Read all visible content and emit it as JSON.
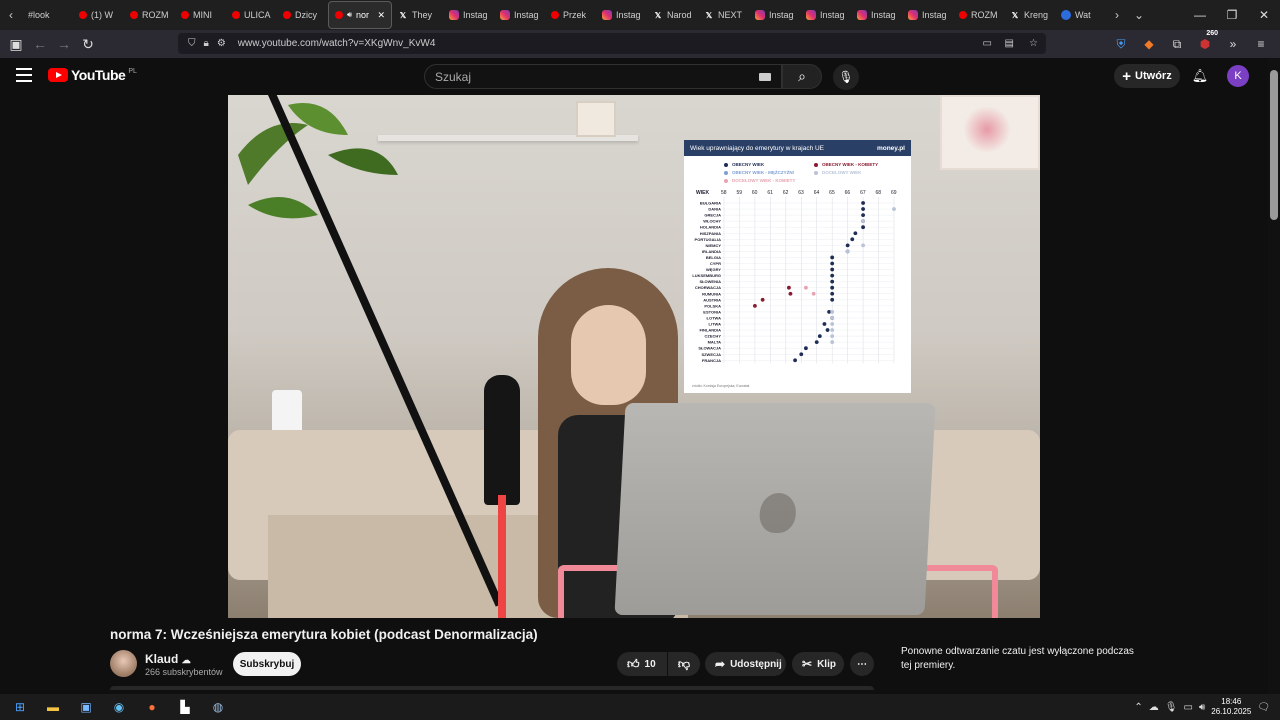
{
  "browser": {
    "tabs": [
      {
        "label": "#look",
        "icon": "none"
      },
      {
        "label": "(1) W",
        "icon": "youtube"
      },
      {
        "label": "ROZM",
        "icon": "youtube"
      },
      {
        "label": "MINI",
        "icon": "youtube"
      },
      {
        "label": "ULICA",
        "icon": "youtube"
      },
      {
        "label": "Dzicy",
        "icon": "youtube"
      },
      {
        "label": "nor",
        "icon": "youtube",
        "active": true
      },
      {
        "label": "They",
        "icon": "x"
      },
      {
        "label": "Instag",
        "icon": "instagram"
      },
      {
        "label": "Instag",
        "icon": "instagram"
      },
      {
        "label": "Przek",
        "icon": "youtube"
      },
      {
        "label": "Instag",
        "icon": "instagram"
      },
      {
        "label": "Narod",
        "icon": "x"
      },
      {
        "label": "NEXT",
        "icon": "x"
      },
      {
        "label": "Instag",
        "icon": "instagram"
      },
      {
        "label": "Instag",
        "icon": "instagram"
      },
      {
        "label": "Instag",
        "icon": "instagram"
      },
      {
        "label": "Instag",
        "icon": "instagram"
      },
      {
        "label": "ROZM",
        "icon": "youtube"
      },
      {
        "label": "Kreng",
        "icon": "x"
      },
      {
        "label": "Wat",
        "icon": "go"
      }
    ],
    "url": "www.youtube.com/watch?v=XKgWnv_KvW4",
    "badge_count": "260"
  },
  "youtube": {
    "logo_text": "YouTube",
    "region": "PL",
    "search_placeholder": "Szukaj",
    "create_label": "Utwórz",
    "avatar_letter": "K"
  },
  "video_chart": {
    "title": "Wiek uprawniający do emerytury w krajach UE",
    "brand": "money.pl",
    "legend": [
      {
        "label": "OBECNY WIEK",
        "color": "#1f2d55"
      },
      {
        "label": "OBECNY WIEK - KOBIETY",
        "color": "#8a1a2f"
      },
      {
        "label": "OBECNY WIEK - MĘŻCZYŹNI",
        "color": "#7f9fd1"
      },
      {
        "label": "DOCELOWY WIEK",
        "color": "#b8c2d8"
      },
      {
        "label": "DOCELOWY WIEK - KOBIETY",
        "color": "#e7a4b0"
      }
    ],
    "axis_label": "WIEK",
    "ticks": [
      "58",
      "59",
      "60",
      "61",
      "62",
      "63",
      "64",
      "65",
      "66",
      "67",
      "68",
      "69"
    ],
    "source": "źródło: Komisja Europejska, Eurostat"
  },
  "chart_data": {
    "type": "scatter",
    "title": "Wiek uprawniający do emerytury w krajach UE",
    "xlabel": "WIEK",
    "xlim": [
      58,
      69
    ],
    "categories": [
      "BUŁGARIA",
      "DANIA",
      "GRECJA",
      "WŁOCHY",
      "HOLANDIA",
      "HISZPANIA",
      "PORTUGALIA",
      "NIEMCY",
      "IRLANDIA",
      "BELGIA",
      "CYPR",
      "WĘGRY",
      "LUKSEMBURG",
      "SŁOWENIA",
      "CHORWACJA",
      "RUMUNIA",
      "AUSTRIA",
      "POLSKA",
      "ESTONIA",
      "ŁOTWA",
      "LITWA",
      "FINLANDIA",
      "CZECHY",
      "MALTA",
      "SŁOWACJA",
      "SZWECJA",
      "FRANCJA"
    ],
    "series": [
      {
        "name": "OBECNY WIEK",
        "values": [
          67,
          67,
          67,
          67,
          67,
          66.5,
          66.3,
          66,
          66,
          65,
          65,
          65,
          65,
          65,
          65,
          65,
          65,
          null,
          64.8,
          65,
          64.5,
          64.7,
          64.2,
          64,
          63.3,
          63,
          62.6
        ]
      },
      {
        "name": "OBECNY WIEK - KOBIETY",
        "values": [
          null,
          null,
          null,
          null,
          null,
          null,
          null,
          null,
          null,
          null,
          null,
          null,
          null,
          null,
          62.2,
          62.3,
          60.5,
          60,
          null,
          null,
          null,
          null,
          null,
          null,
          null,
          null,
          null
        ]
      },
      {
        "name": "DOCELOWY WIEK",
        "values": [
          null,
          69,
          null,
          67,
          null,
          null,
          null,
          67,
          66,
          null,
          null,
          null,
          null,
          null,
          null,
          null,
          null,
          null,
          65,
          65,
          65,
          65,
          65,
          65,
          null,
          null,
          null
        ]
      },
      {
        "name": "DOCELOWY WIEK - KOBIETY",
        "values": [
          null,
          null,
          null,
          null,
          null,
          null,
          null,
          null,
          null,
          null,
          null,
          null,
          null,
          null,
          63.3,
          63.8,
          null,
          null,
          null,
          null,
          null,
          null,
          null,
          null,
          null,
          null,
          null
        ]
      }
    ]
  },
  "video": {
    "title": "norma 7: Wcześniejsza emerytura kobiet (podcast Denormalizacja)",
    "channel": "Klaud",
    "subscribers": "266 subskrybentów",
    "subscribe_label": "Subskrybuj",
    "likes": "10",
    "share_label": "Udostępnij",
    "clip_label": "Klip",
    "chat_note": "Ponowne odtwarzanie czatu jest wyłączone podczas tej premiery."
  },
  "taskbar": {
    "time": "18:46",
    "date": "26.10.2025"
  }
}
